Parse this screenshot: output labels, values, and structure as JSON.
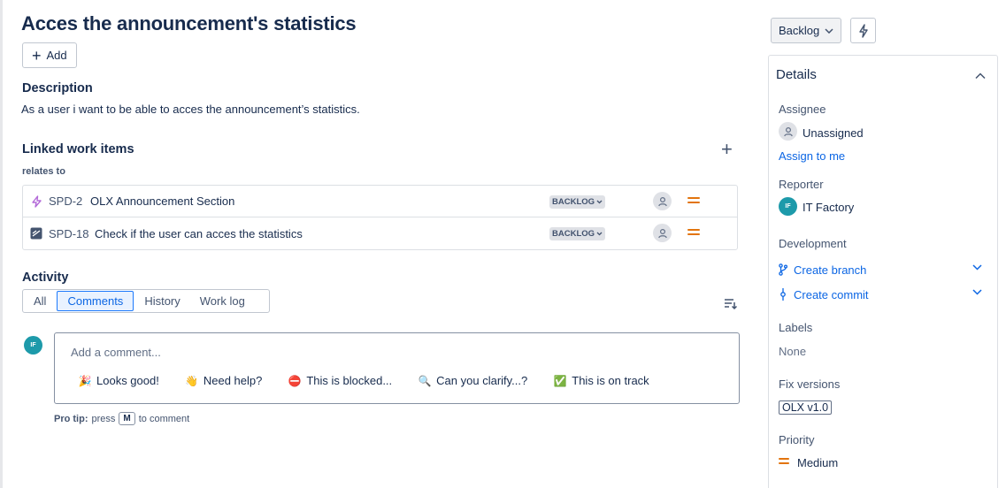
{
  "issue": {
    "title": "Acces the announcement's statistics",
    "add_label": "Add"
  },
  "description": {
    "heading": "Description",
    "text": "As a user i want to be able to acces the announcement’s statistics."
  },
  "linked": {
    "heading": "Linked work items",
    "relation": "relates to",
    "items": [
      {
        "key": "SPD-2",
        "summary": "OLX Announcement Section",
        "status": "BACKLOG",
        "type_icon": "epic-lightning-icon",
        "priority": "medium"
      },
      {
        "key": "SPD-18",
        "summary": "Check if the user can acces the statistics",
        "status": "BACKLOG",
        "type_icon": "task-icon",
        "priority": "medium"
      }
    ]
  },
  "activity": {
    "heading": "Activity",
    "tabs": [
      "All",
      "Comments",
      "History",
      "Work log"
    ],
    "active_tab": "Comments",
    "avatar_initials": "IF",
    "comment_placeholder": "Add a comment...",
    "quick_replies": [
      {
        "emoji": "🎉",
        "label": "Looks good!"
      },
      {
        "emoji": "👋",
        "label": "Need help?"
      },
      {
        "emoji": "⛔",
        "label": "This is blocked..."
      },
      {
        "emoji": "🔍",
        "label": "Can you clarify...?"
      },
      {
        "emoji": "✅",
        "label": "This is on track"
      }
    ],
    "protip_bold": "Pro tip:",
    "protip_pre": "press",
    "protip_key": "M",
    "protip_post": "to comment"
  },
  "sidebar": {
    "status_button": "Backlog",
    "details_heading": "Details",
    "assignee_label": "Assignee",
    "assignee_value": "Unassigned",
    "assign_to_me": "Assign to me",
    "reporter_label": "Reporter",
    "reporter_initials": "IF",
    "reporter_value": "IT Factory",
    "development_label": "Development",
    "create_branch": "Create branch",
    "create_commit": "Create commit",
    "labels_label": "Labels",
    "labels_value": "None",
    "fix_versions_label": "Fix versions",
    "fix_version_value": "OLX v1.0",
    "priority_label": "Priority",
    "priority_value": "Medium"
  },
  "colors": {
    "accent": "#0c66e4",
    "priority_medium": "#e2740d",
    "avatar_teal": "#1d9aaa",
    "epic_purple": "#b36ad8"
  }
}
